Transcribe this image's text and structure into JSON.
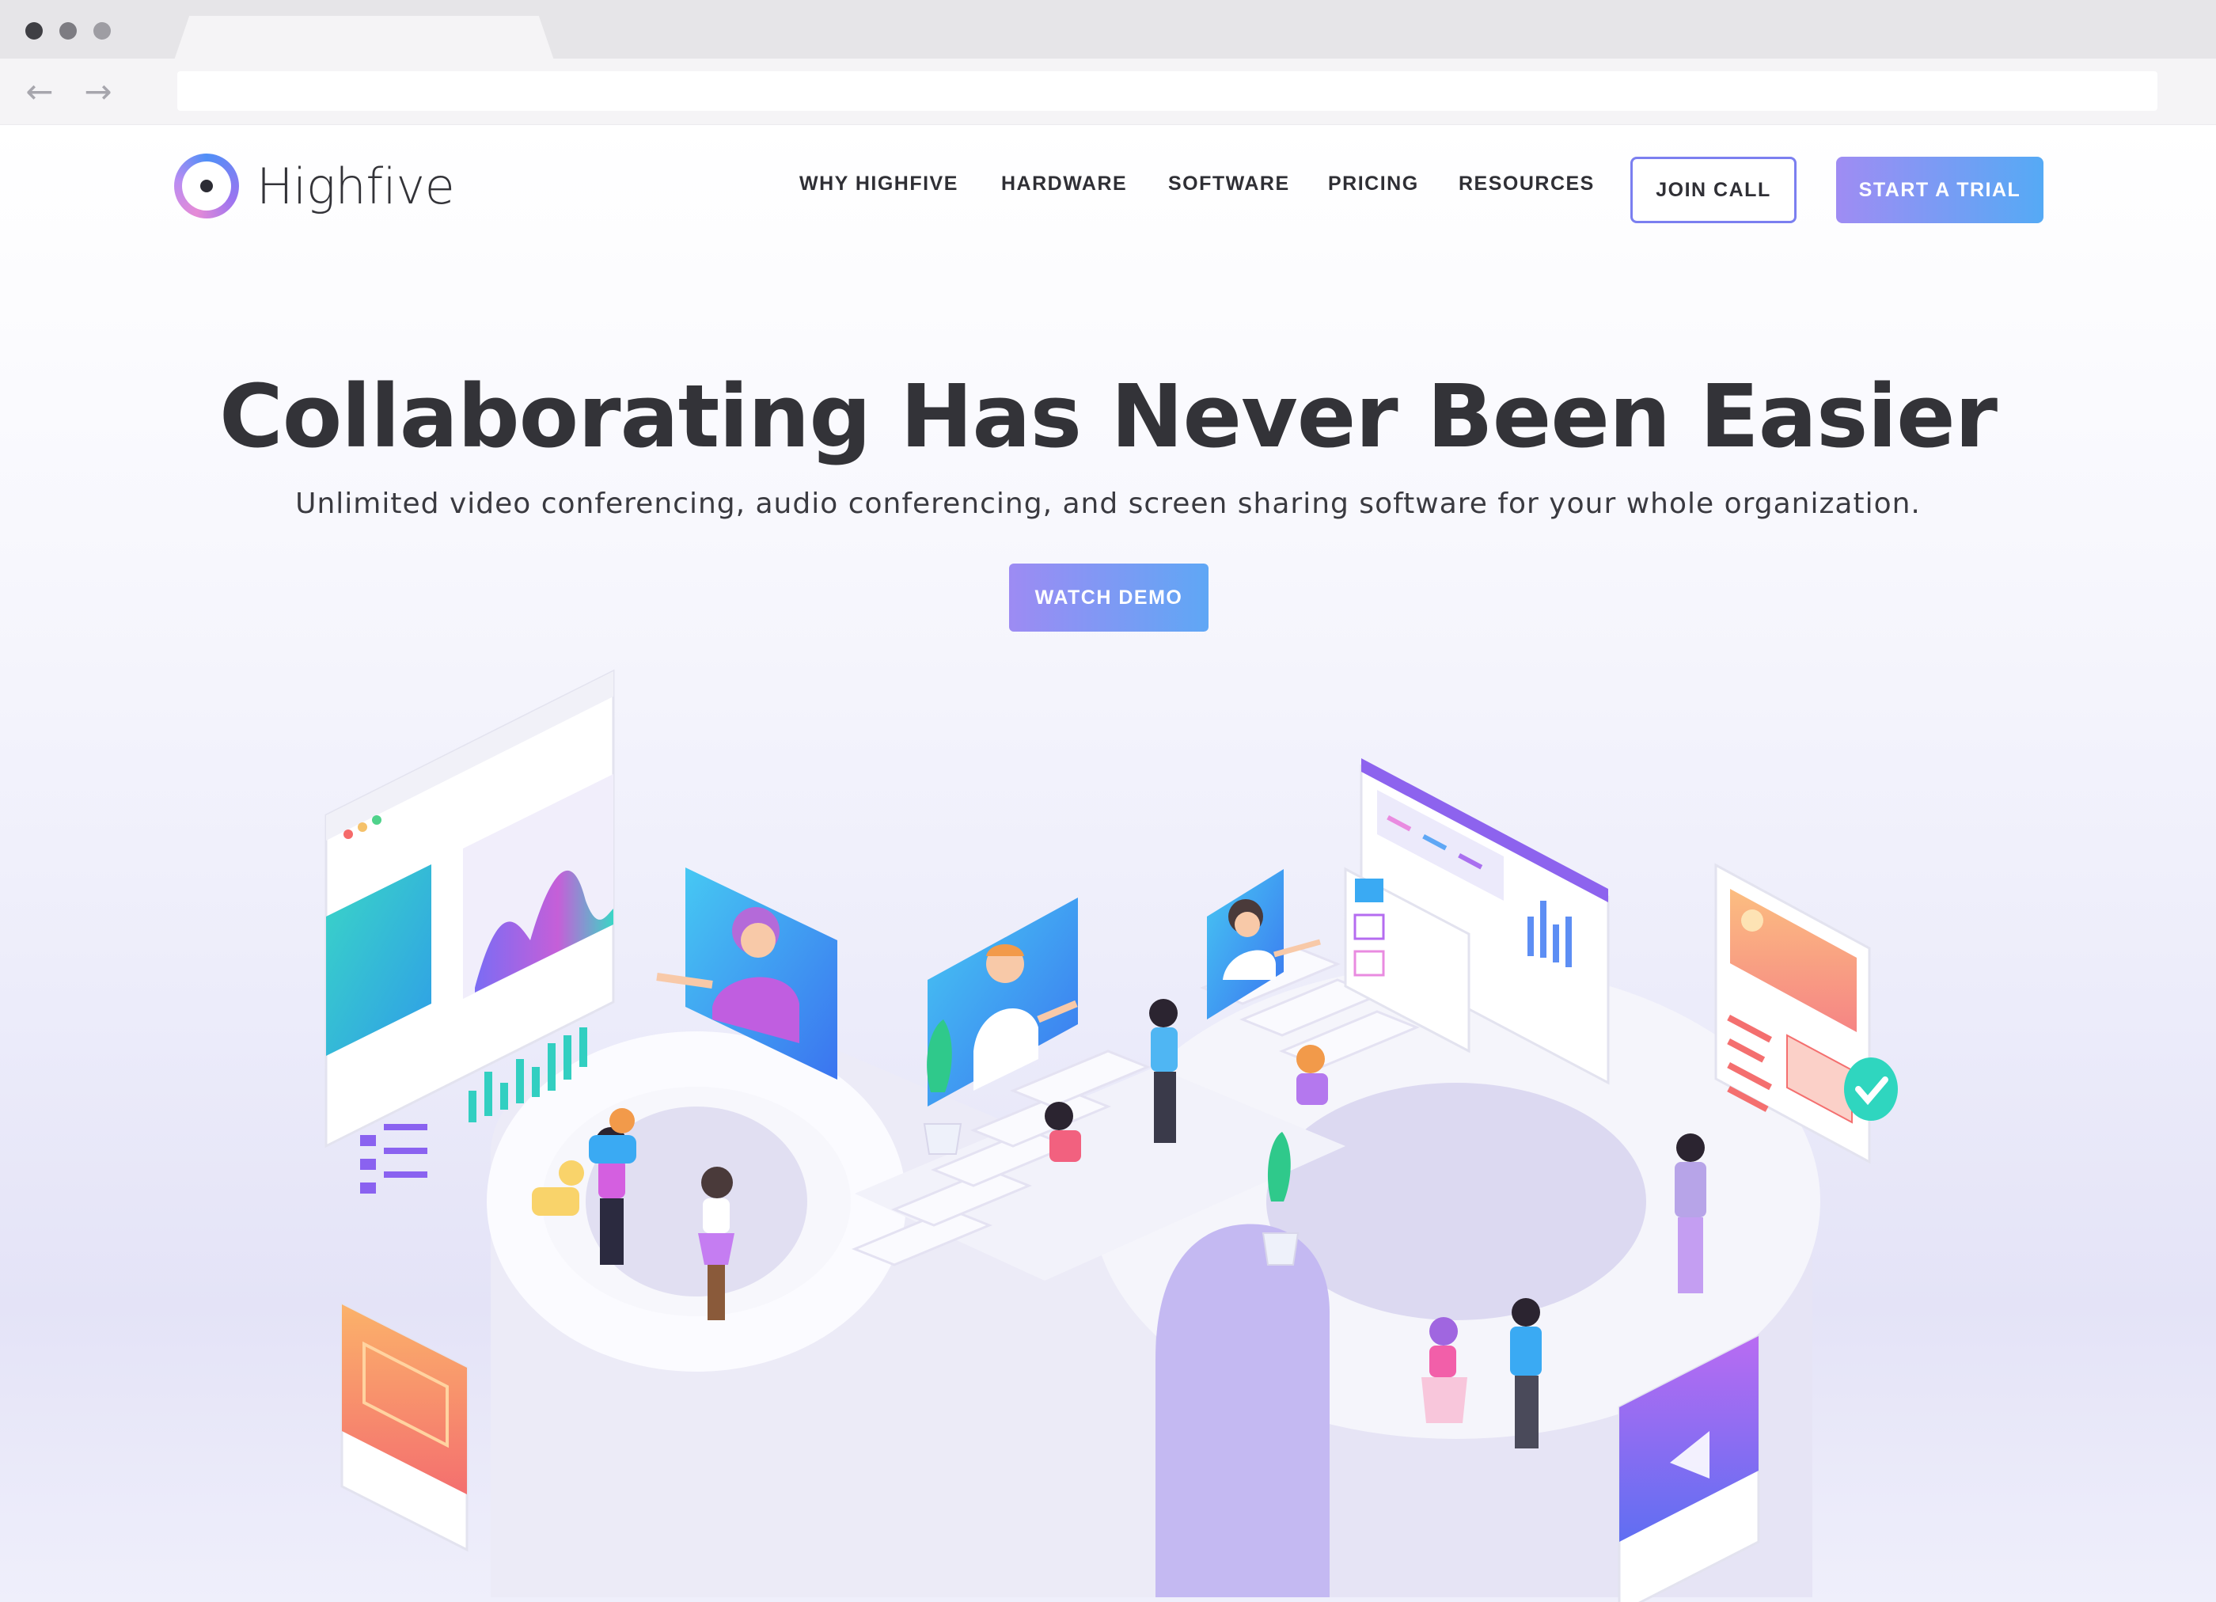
{
  "browser": {
    "back_icon": "←",
    "forward_icon": "→",
    "address": ""
  },
  "brand": {
    "name": "Highfive",
    "colors": {
      "accent_purple": "#9f8cf3",
      "accent_blue": "#55aaf5",
      "outline": "#7b7ff0",
      "text_dark": "#333338"
    }
  },
  "nav": {
    "items": [
      {
        "label": "WHY HIGHFIVE"
      },
      {
        "label": "HARDWARE"
      },
      {
        "label": "SOFTWARE"
      },
      {
        "label": "PRICING"
      },
      {
        "label": "RESOURCES"
      }
    ],
    "join_call_label": "JOIN CALL",
    "start_trial_label": "START A TRIAL"
  },
  "hero": {
    "title": "Collaborating Has Never Been Easier",
    "subtitle": "Unlimited video conferencing, audio conferencing, and screen sharing software for your whole organization.",
    "cta_label": "WATCH DEMO"
  }
}
